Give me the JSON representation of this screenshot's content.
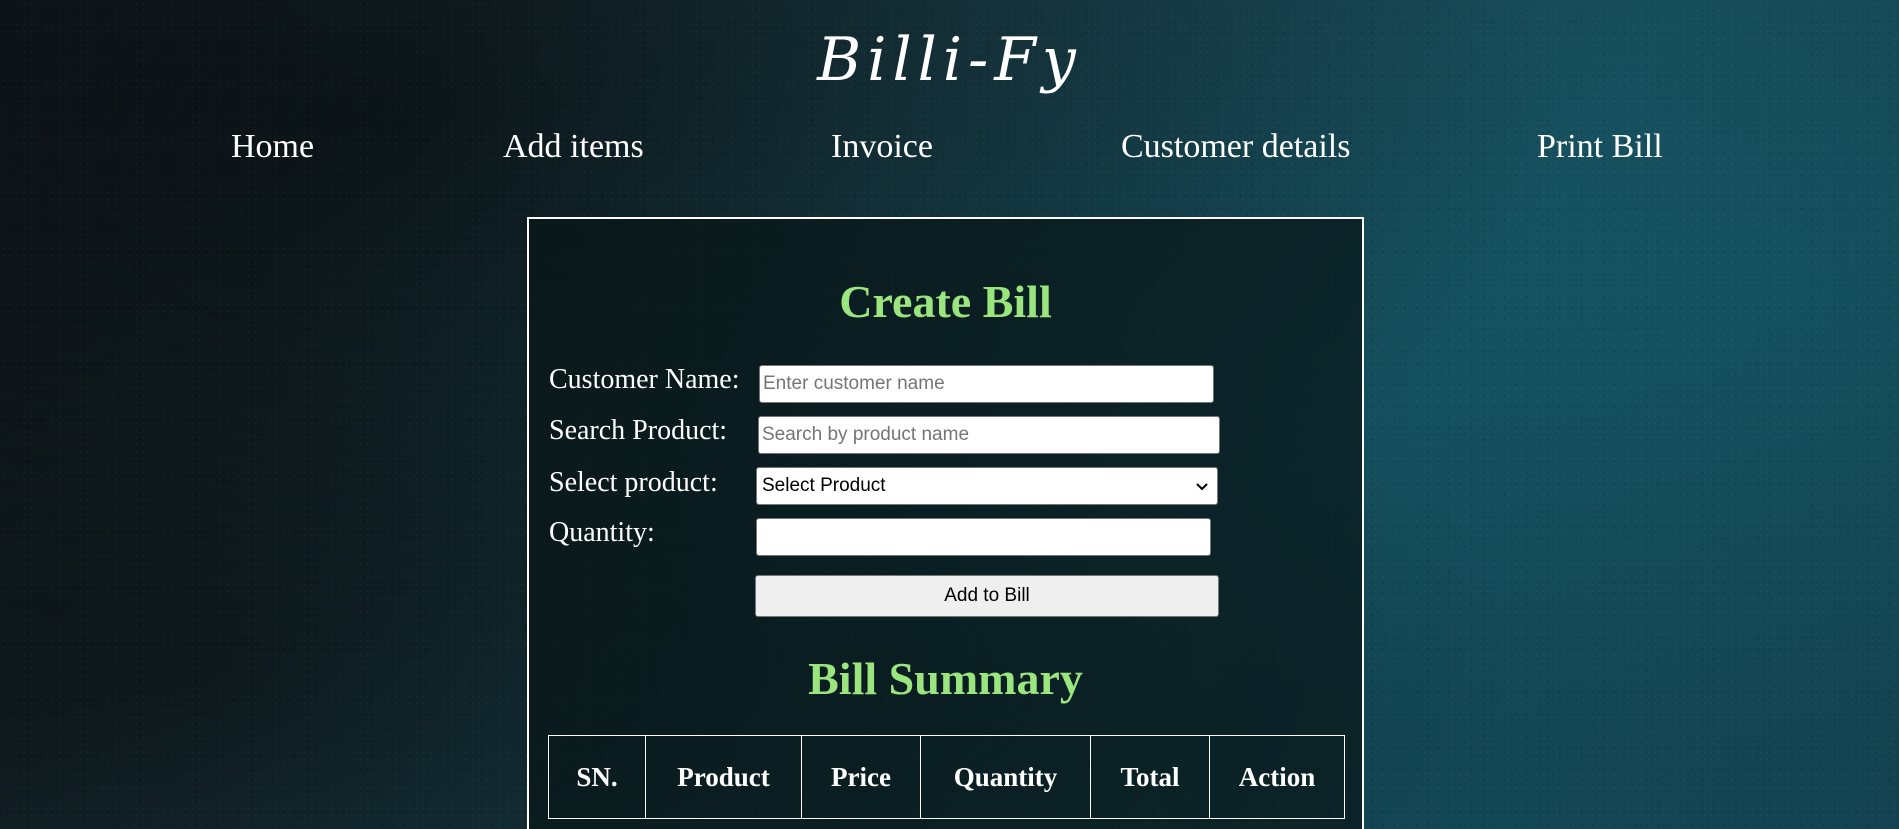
{
  "app": {
    "logo": "Billi-Fy"
  },
  "nav": {
    "items": [
      {
        "label": "Home"
      },
      {
        "label": "Add items"
      },
      {
        "label": "Invoice"
      },
      {
        "label": "Customer details"
      },
      {
        "label": "Print Bill"
      }
    ]
  },
  "create_bill": {
    "title": "Create Bill",
    "customer_name_label": "Customer Name:",
    "customer_name_placeholder": "Enter customer name",
    "customer_name_value": "",
    "search_product_label": "Search Product:",
    "search_product_placeholder": "Search by product name",
    "search_product_value": "",
    "select_product_label": "Select product:",
    "select_product_value": "Select Product",
    "quantity_label": "Quantity:",
    "quantity_value": "",
    "add_button_label": "Add to Bill"
  },
  "bill_summary": {
    "title": "Bill Summary",
    "columns": [
      "SN.",
      "Product",
      "Price",
      "Quantity",
      "Total",
      "Action"
    ]
  },
  "colors": {
    "heading": "#9be57f",
    "text": "#ffffff",
    "panel_border": "#ffffff"
  },
  "icons": {
    "select_dropdown": "chevron-down-icon"
  }
}
